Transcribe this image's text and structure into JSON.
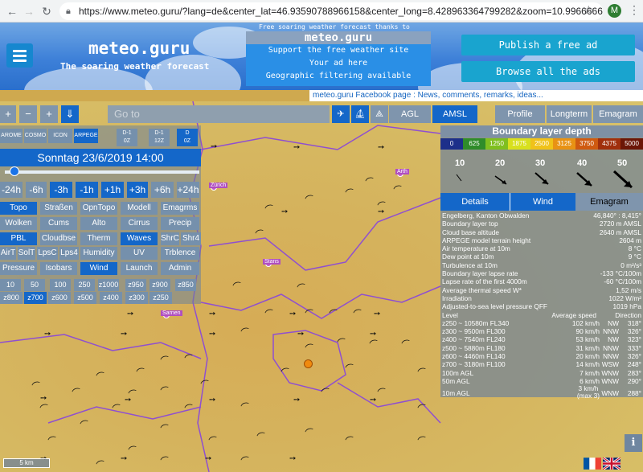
{
  "browser": {
    "url": "https://www.meteo.guru/?lang=de&center_lat=46.93590788966158&center_long=8.428963364799282&zoom=10.996666666...",
    "avatar_letter": "M"
  },
  "header": {
    "title": "meteo.guru",
    "tagline": "The soaring weather forecast",
    "sponsor_text": "Free soaring weather forecast thanks to",
    "ad_title": "meteo.guru",
    "ad_lines": [
      "Support the free weather site",
      "Your ad here",
      "Geographic filtering available"
    ],
    "publish_btn": "Publish a free ad",
    "browse_btn": "Browse all the ads"
  },
  "facebook_text": "meteo.guru Facebook page : News, comments, remarks, ideas...",
  "toolbar": {
    "plus": "+",
    "minus": "−",
    "plus2": "+",
    "goto_placeholder": "Go to",
    "agl": "AGL",
    "amsl": "AMSL",
    "profile": "Profile",
    "longterm": "Longterm",
    "emagram": "Emagram"
  },
  "models": [
    "AROME",
    "COSMO",
    "ICON",
    "ARPEGE"
  ],
  "runs": [
    "D-1\n0Z",
    "D-1\n12Z",
    "D\n0Z"
  ],
  "date": "Sonntag 23/6/2019 14:00",
  "time_steps": [
    "-24h",
    "-6h",
    "-3h",
    "-1h",
    "+1h",
    "+3h",
    "+6h",
    "+24h"
  ],
  "layers": {
    "row1": [
      "Topo",
      "Straßen",
      "OpnTopo",
      "Modell",
      "Emagrms"
    ],
    "row2": [
      "Wolken",
      "Cums",
      "Alto",
      "Cirrus",
      "Precip"
    ],
    "row3": [
      "PBL",
      "Cloudbse",
      "Therm",
      "Waves",
      "ShrC",
      "Shr4"
    ],
    "row4": [
      "AirT",
      "SolT",
      "LpsC",
      "Lps4",
      "Humidity",
      "UV",
      "Trblence"
    ],
    "row5": [
      "Pressure",
      "Isobars",
      "Wind",
      "Launch",
      "Admin"
    ]
  },
  "levels": {
    "row1": [
      "10",
      "50",
      "100",
      "250",
      "z1000",
      "z950",
      "z900",
      "z850"
    ],
    "row2": [
      "z800",
      "z700",
      "z600",
      "z500",
      "z400",
      "z300",
      "z250"
    ]
  },
  "boundary": {
    "title": "Boundary layer depth",
    "scale": [
      "0",
      "625",
      "1250",
      "1875",
      "2500",
      "3125",
      "3750",
      "4375",
      "5000"
    ],
    "scale_colors": [
      "#1d2f8a",
      "#2f8c2a",
      "#7fbf1f",
      "#d8e01e",
      "#f0c21a",
      "#e89214",
      "#cf5a10",
      "#a02f0c",
      "#6b1607"
    ],
    "wind_alts": [
      "10",
      "20",
      "30",
      "40",
      "50"
    ]
  },
  "tabs": {
    "details": "Details",
    "wind": "Wind",
    "emagram": "Emagram"
  },
  "details": [
    {
      "k": "Engelberg, Kanton Obwalden",
      "v": "46,840° : 8,415°"
    },
    {
      "k": "Boundary layer top",
      "v": "2720 m AMSL"
    },
    {
      "k": "Cloud base altitude",
      "v": "2640 m AMSL"
    },
    {
      "k": "ARPEGE model terrain height",
      "v": "2604 m"
    },
    {
      "k": "Air temperature at 10m",
      "v": "8 °C"
    },
    {
      "k": "Dew point at 10m",
      "v": "9 °C"
    },
    {
      "k": "Turbulence at 10m",
      "v": "0 m²/s³"
    },
    {
      "k": "Boundary layer lapse rate",
      "v": "-133 °C/100m"
    },
    {
      "k": "Lapse rate of the first 4000m",
      "v": "-60 °C/100m"
    },
    {
      "k": "Average thermal speed W*",
      "v": "1,52 m/s"
    },
    {
      "k": "Irradiation",
      "v": "1022 W/m²"
    },
    {
      "k": "Adjusted-to-sea level pressure QFF",
      "v": "1019 hPa"
    }
  ],
  "wind_head": {
    "level": "Level",
    "speed": "Average speed",
    "dir": "Direction"
  },
  "wind_rows": [
    {
      "level": "z250 ~ 10580m FL340",
      "speed": "102 km/h",
      "card": "NW",
      "deg": "318°"
    },
    {
      "level": "z300 ~ 9500m FL300",
      "speed": "90 km/h",
      "card": "NNW",
      "deg": "326°"
    },
    {
      "level": "z400 ~ 7540m FL240",
      "speed": "53 km/h",
      "card": "NW",
      "deg": "323°"
    },
    {
      "level": "z500 ~ 5880m FL180",
      "speed": "31 km/h",
      "card": "NNW",
      "deg": "333°"
    },
    {
      "level": "z600 ~ 4460m FL140",
      "speed": "20 km/h",
      "card": "NNW",
      "deg": "326°"
    },
    {
      "level": "z700 ~ 3180m FL100",
      "speed": "14 km/h",
      "card": "WSW",
      "deg": "248°"
    },
    {
      "level": "100m AGL",
      "speed": "7 km/h",
      "card": "WNW",
      "deg": "283°"
    },
    {
      "level": "50m AGL",
      "speed": "6 km/h",
      "card": "WNW",
      "deg": "290°"
    },
    {
      "level": "10m AGL",
      "speed": "3 km/h\n(max 3)",
      "card": "WNW",
      "deg": "288°"
    }
  ],
  "map": {
    "towns": [
      "Zürich",
      "Arth",
      "Stans",
      "Sarnen"
    ],
    "scale_label": "5 km",
    "info_label": "i"
  }
}
